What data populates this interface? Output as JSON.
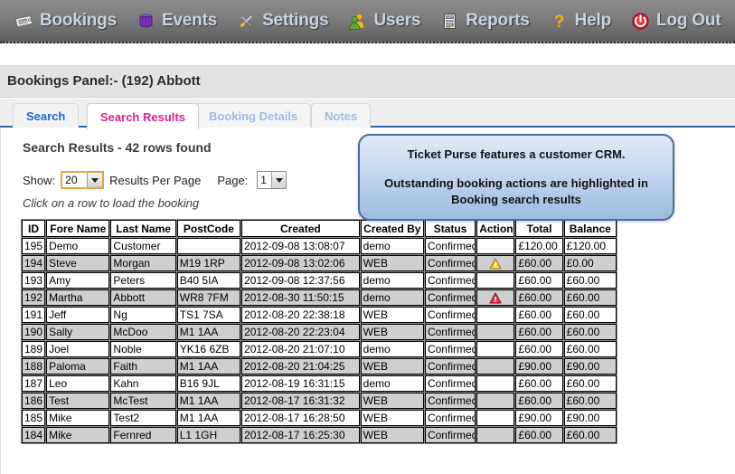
{
  "navbar": {
    "items": [
      {
        "label": "Bookings",
        "icon": "ticket-icon",
        "active": true
      },
      {
        "label": "Events",
        "icon": "events-icon",
        "active": false
      },
      {
        "label": "Settings",
        "icon": "settings-tools-icon",
        "active": false
      },
      {
        "label": "Users",
        "icon": "users-icon",
        "active": false
      },
      {
        "label": "Reports",
        "icon": "reports-icon",
        "active": false
      },
      {
        "label": "Help",
        "icon": "question-mark-icon",
        "active": false
      },
      {
        "label": "Log Out",
        "icon": "power-icon",
        "active": false
      }
    ]
  },
  "panel": {
    "title": "Bookings Panel:- (192) Abbott"
  },
  "tabs": [
    {
      "label": "Search",
      "state": "inactive-link"
    },
    {
      "label": "Search Results",
      "state": "active"
    },
    {
      "label": "Booking Details",
      "state": "disabled"
    },
    {
      "label": "Notes",
      "state": "disabled"
    }
  ],
  "callout": {
    "line1": "Ticket Purse features a customer CRM.",
    "line2": "Outstanding booking actions are highlighted in Booking search results"
  },
  "results": {
    "heading": "Search Results - 42 rows found",
    "rows_found": 42,
    "show_label": "Show:",
    "per_page_value": "20",
    "per_page_label": "Results Per Page",
    "page_label": "Page:",
    "page_value": "1",
    "hint": "Click on a row to load the booking",
    "columns": [
      "ID",
      "Fore Name",
      "Last Name",
      "PostCode",
      "Created",
      "Created By",
      "Status",
      "Actions",
      "Total",
      "Balance"
    ],
    "rows": [
      {
        "id": "195",
        "fore_name": "Demo",
        "last_name": "Customer",
        "postcode": "",
        "created": "2012-09-08 13:08:07",
        "created_by": "demo",
        "status": "Confirmed",
        "action": "",
        "total": "£120.00",
        "balance": "£120.00"
      },
      {
        "id": "194",
        "fore_name": "Steve",
        "last_name": "Morgan",
        "postcode": "M19 1RP",
        "created": "2012-09-08 13:02:06",
        "created_by": "WEB",
        "status": "Confirmed",
        "action": "warning-amber",
        "total": "£60.00",
        "balance": "£0.00"
      },
      {
        "id": "193",
        "fore_name": "Amy",
        "last_name": "Peters",
        "postcode": "B40 5IA",
        "created": "2012-09-08 12:37:56",
        "created_by": "demo",
        "status": "Confirmed",
        "action": "",
        "total": "£60.00",
        "balance": "£60.00"
      },
      {
        "id": "192",
        "fore_name": "Martha",
        "last_name": "Abbott",
        "postcode": "WR8 7FM",
        "created": "2012-08-30 11:50:15",
        "created_by": "demo",
        "status": "Confirmed",
        "action": "warning-red",
        "total": "£60.00",
        "balance": "£60.00"
      },
      {
        "id": "191",
        "fore_name": "Jeff",
        "last_name": "Ng",
        "postcode": "TS1 7SA",
        "created": "2012-08-20 22:38:18",
        "created_by": "WEB",
        "status": "Confirmed",
        "action": "",
        "total": "£60.00",
        "balance": "£60.00"
      },
      {
        "id": "190",
        "fore_name": "Sally",
        "last_name": "McDoo",
        "postcode": "M1 1AA",
        "created": "2012-08-20 22:23:04",
        "created_by": "WEB",
        "status": "Confirmed",
        "action": "",
        "total": "£60.00",
        "balance": "£60.00"
      },
      {
        "id": "189",
        "fore_name": "Joel",
        "last_name": "Noble",
        "postcode": "YK16 6ZB",
        "created": "2012-08-20 21:07:10",
        "created_by": "demo",
        "status": "Confirmed",
        "action": "",
        "total": "£60.00",
        "balance": "£60.00"
      },
      {
        "id": "188",
        "fore_name": "Paloma",
        "last_name": "Faith",
        "postcode": "M1 1AA",
        "created": "2012-08-20 21:04:25",
        "created_by": "WEB",
        "status": "Confirmed",
        "action": "",
        "total": "£90.00",
        "balance": "£90.00"
      },
      {
        "id": "187",
        "fore_name": "Leo",
        "last_name": "Kahn",
        "postcode": "B16 9JL",
        "created": "2012-08-19 16:31:15",
        "created_by": "demo",
        "status": "Confirmed",
        "action": "",
        "total": "£60.00",
        "balance": "£60.00"
      },
      {
        "id": "186",
        "fore_name": "Test",
        "last_name": "McTest",
        "postcode": "M1 1AA",
        "created": "2012-08-17 16:31:32",
        "created_by": "WEB",
        "status": "Confirmed",
        "action": "",
        "total": "£60.00",
        "balance": "£60.00"
      },
      {
        "id": "185",
        "fore_name": "Mike",
        "last_name": "Test2",
        "postcode": "M1 1AA",
        "created": "2012-08-17 16:28:50",
        "created_by": "WEB",
        "status": "Confirmed",
        "action": "",
        "total": "£90.00",
        "balance": "£90.00"
      },
      {
        "id": "184",
        "fore_name": "Mike",
        "last_name": "Fernred",
        "postcode": "L1 1GH",
        "created": "2012-08-17 16:25:30",
        "created_by": "WEB",
        "status": "Confirmed",
        "action": "",
        "total": "£60.00",
        "balance": "£60.00"
      }
    ]
  },
  "colors": {
    "nav_text": "#c9d4e2",
    "active_tab_text": "#e0218a",
    "link_tab_text": "#1c6ad6",
    "disabled_tab_text": "#9dbbe0",
    "callout_border": "#4c6d9c",
    "focus_outline": "#e8a33d",
    "warning_amber": "#f5d34a",
    "warning_red": "#e0365c",
    "row_alt_bg": "#cfcfcf"
  }
}
